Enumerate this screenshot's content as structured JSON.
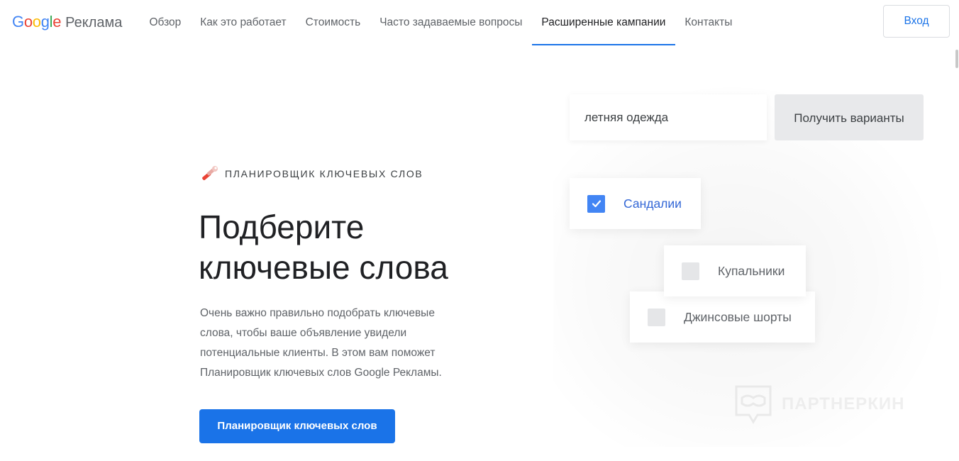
{
  "header": {
    "logo_text": "Google",
    "product": "Реклама",
    "nav": [
      {
        "label": "Обзор"
      },
      {
        "label": "Как это работает"
      },
      {
        "label": "Стоимость"
      },
      {
        "label": "Часто задаваемые вопросы"
      },
      {
        "label": "Расширенные кампании",
        "active": true
      },
      {
        "label": "Контакты"
      }
    ],
    "login_label": "Вход"
  },
  "hero": {
    "eyebrow": "ПЛАНИРОВЩИК КЛЮЧЕВЫХ СЛОВ",
    "eyebrow_icon": "wrench-icon",
    "title_lines": [
      "Подберите",
      "ключевые слова"
    ],
    "description_lines": [
      "Очень важно правильно подобрать ключевые",
      "слова, чтобы ваше объявление увидели",
      "потенциальные клиенты. В этом вам поможет",
      "Планировщик ключевых слов Google Рекламы."
    ],
    "cta_label": "Планировщик ключевых слов"
  },
  "illustration": {
    "search_value": "летняя одежда",
    "get_button": "Получить варианты",
    "suggestions": [
      {
        "label": "Сандалии",
        "checked": true
      },
      {
        "label": "Купальники",
        "checked": false
      },
      {
        "label": "Джинсовые шорты",
        "checked": false
      }
    ]
  },
  "watermark": {
    "text": "ПАРТНЕРКИН",
    "icon": "mask-icon"
  },
  "colors": {
    "accent": "#1a73e8",
    "checkbox_checked": "#4285f4",
    "google_blue": "#4285F4",
    "google_red": "#EA4335",
    "google_yellow": "#FBBC05",
    "google_green": "#34A853"
  }
}
